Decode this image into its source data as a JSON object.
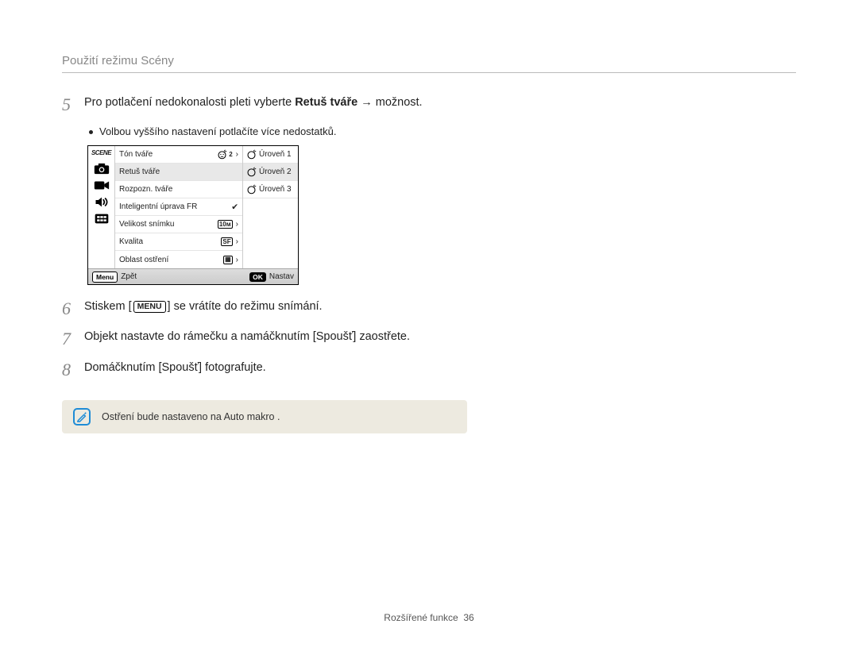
{
  "header": {
    "title": "Použití režimu Scény"
  },
  "steps": {
    "s5": {
      "num": "5",
      "text_pre": "Pro potlačení nedokonalosti pleti vyberte ",
      "text_bold": "Retuš tváře",
      "text_arrow": " → ",
      "text_post": "možnost.",
      "bullet": "Volbou vyššího nastavení potlačíte více nedostatků."
    },
    "s6": {
      "num": "6",
      "text_pre": "Stiskem [",
      "menu_label": "MENU",
      "text_post": "] se vrátíte do režimu snímání."
    },
    "s7": {
      "num": "7",
      "text": "Objekt nastavte do rámečku a namáčknutím [Spoušť] zaostřete."
    },
    "s8": {
      "num": "8",
      "text": "Domáčknutím [Spoušť] fotografujte."
    }
  },
  "camera": {
    "mode_label": "SCENE",
    "rows": {
      "r0": {
        "label": "Tón tváře"
      },
      "r1": {
        "label": "Retuš tváře"
      },
      "r2": {
        "label": "Rozpozn. tváře"
      },
      "r3": {
        "label": "Inteligentní úprava FR"
      },
      "r4": {
        "label": "Velikost snímku"
      },
      "r5": {
        "label": "Kvalita"
      },
      "r6": {
        "label": "Oblast ostření"
      }
    },
    "levels": {
      "l1": "Úroveň 1",
      "l2": "Úroveň 2",
      "l3": "Úroveň 3"
    },
    "value_badges": {
      "size": "10м",
      "quality": "SF"
    },
    "footer": {
      "menu": "Menu",
      "back": "Zpět",
      "ok": "OK",
      "set": "Nastav"
    }
  },
  "note": {
    "text": "Ostření bude nastaveno na Auto makro ."
  },
  "footer": {
    "section": "Rozšířené funkce",
    "page": "36"
  }
}
